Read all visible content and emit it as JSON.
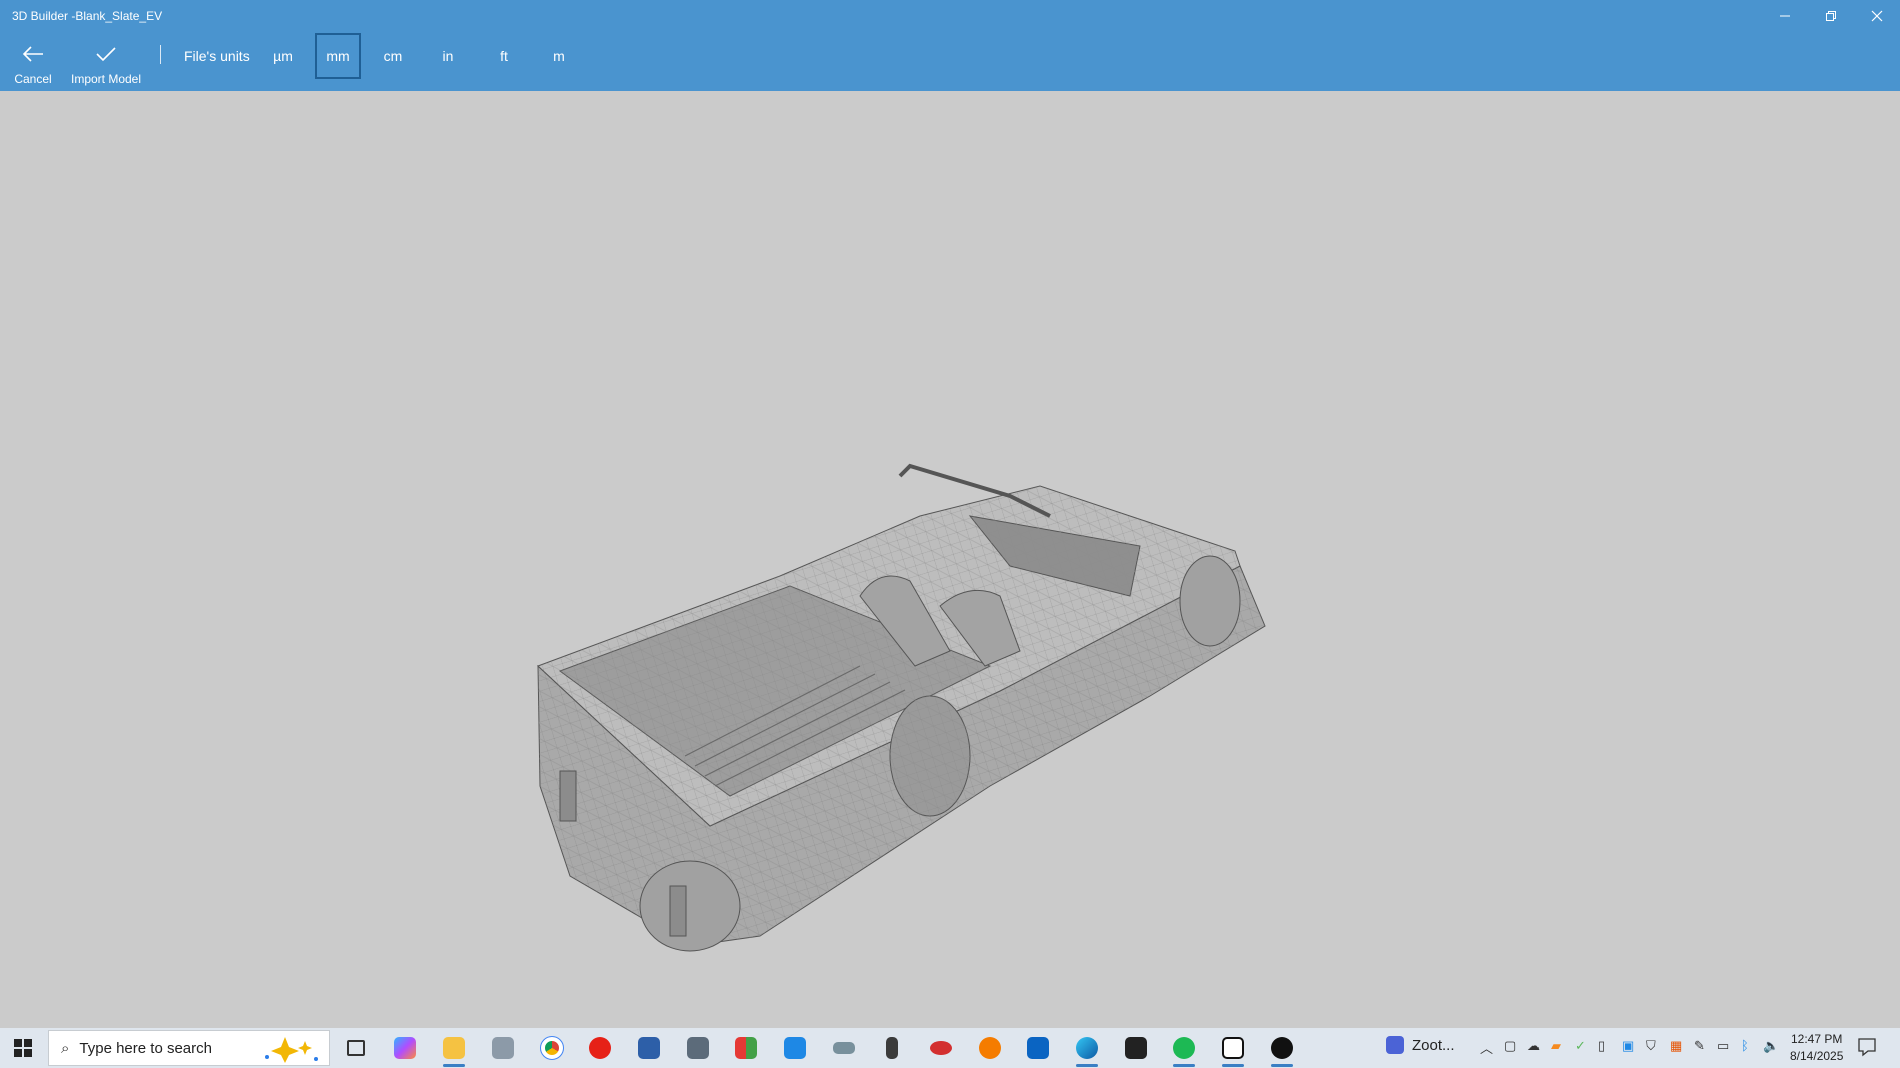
{
  "window": {
    "title": "3D Builder -Blank_Slate_EV",
    "minimize_icon": "minimize-icon",
    "restore_icon": "restore-icon",
    "close_icon": "close-icon"
  },
  "toolbar": {
    "cancel_label": "Cancel",
    "import_label": "Import Model",
    "units_label": "File's units",
    "units": [
      "µm",
      "mm",
      "cm",
      "in",
      "ft",
      "m"
    ],
    "selected_unit": "mm"
  },
  "taskbar": {
    "search_placeholder": "Type here to search",
    "zotero_label": "Zoot...",
    "time": "12:47 PM",
    "date": "8/14/2025"
  },
  "colors": {
    "accent": "#4a94cf",
    "selected_border": "#1f5f95",
    "viewport": "#cbcbcb",
    "taskbar": "#dfe6ee"
  }
}
